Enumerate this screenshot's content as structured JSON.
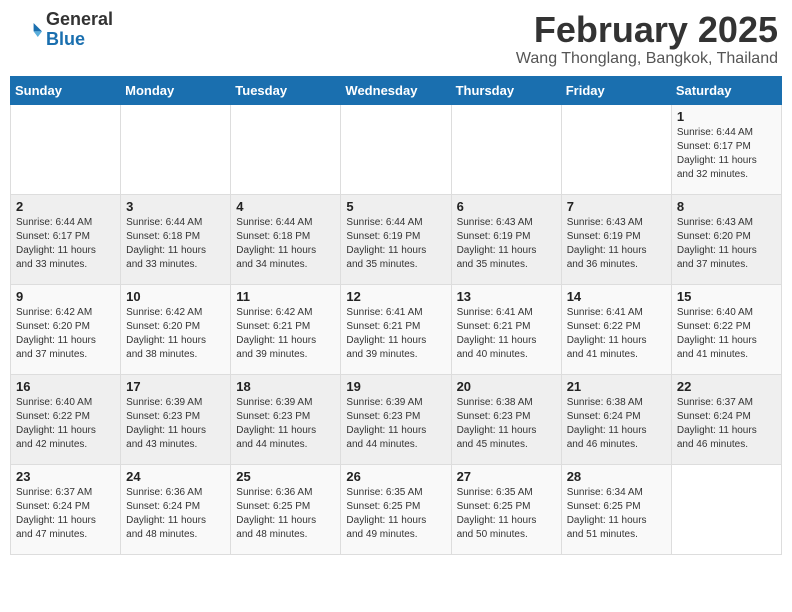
{
  "header": {
    "logo_general": "General",
    "logo_blue": "Blue",
    "month_year": "February 2025",
    "location": "Wang Thonglang, Bangkok, Thailand"
  },
  "weekdays": [
    "Sunday",
    "Monday",
    "Tuesday",
    "Wednesday",
    "Thursday",
    "Friday",
    "Saturday"
  ],
  "weeks": [
    {
      "days": [
        {
          "num": "",
          "info": ""
        },
        {
          "num": "",
          "info": ""
        },
        {
          "num": "",
          "info": ""
        },
        {
          "num": "",
          "info": ""
        },
        {
          "num": "",
          "info": ""
        },
        {
          "num": "",
          "info": ""
        },
        {
          "num": "1",
          "info": "Sunrise: 6:44 AM\nSunset: 6:17 PM\nDaylight: 11 hours\nand 32 minutes."
        }
      ]
    },
    {
      "days": [
        {
          "num": "2",
          "info": "Sunrise: 6:44 AM\nSunset: 6:17 PM\nDaylight: 11 hours\nand 33 minutes."
        },
        {
          "num": "3",
          "info": "Sunrise: 6:44 AM\nSunset: 6:18 PM\nDaylight: 11 hours\nand 33 minutes."
        },
        {
          "num": "4",
          "info": "Sunrise: 6:44 AM\nSunset: 6:18 PM\nDaylight: 11 hours\nand 34 minutes."
        },
        {
          "num": "5",
          "info": "Sunrise: 6:44 AM\nSunset: 6:19 PM\nDaylight: 11 hours\nand 35 minutes."
        },
        {
          "num": "6",
          "info": "Sunrise: 6:43 AM\nSunset: 6:19 PM\nDaylight: 11 hours\nand 35 minutes."
        },
        {
          "num": "7",
          "info": "Sunrise: 6:43 AM\nSunset: 6:19 PM\nDaylight: 11 hours\nand 36 minutes."
        },
        {
          "num": "8",
          "info": "Sunrise: 6:43 AM\nSunset: 6:20 PM\nDaylight: 11 hours\nand 37 minutes."
        }
      ]
    },
    {
      "days": [
        {
          "num": "9",
          "info": "Sunrise: 6:42 AM\nSunset: 6:20 PM\nDaylight: 11 hours\nand 37 minutes."
        },
        {
          "num": "10",
          "info": "Sunrise: 6:42 AM\nSunset: 6:20 PM\nDaylight: 11 hours\nand 38 minutes."
        },
        {
          "num": "11",
          "info": "Sunrise: 6:42 AM\nSunset: 6:21 PM\nDaylight: 11 hours\nand 39 minutes."
        },
        {
          "num": "12",
          "info": "Sunrise: 6:41 AM\nSunset: 6:21 PM\nDaylight: 11 hours\nand 39 minutes."
        },
        {
          "num": "13",
          "info": "Sunrise: 6:41 AM\nSunset: 6:21 PM\nDaylight: 11 hours\nand 40 minutes."
        },
        {
          "num": "14",
          "info": "Sunrise: 6:41 AM\nSunset: 6:22 PM\nDaylight: 11 hours\nand 41 minutes."
        },
        {
          "num": "15",
          "info": "Sunrise: 6:40 AM\nSunset: 6:22 PM\nDaylight: 11 hours\nand 41 minutes."
        }
      ]
    },
    {
      "days": [
        {
          "num": "16",
          "info": "Sunrise: 6:40 AM\nSunset: 6:22 PM\nDaylight: 11 hours\nand 42 minutes."
        },
        {
          "num": "17",
          "info": "Sunrise: 6:39 AM\nSunset: 6:23 PM\nDaylight: 11 hours\nand 43 minutes."
        },
        {
          "num": "18",
          "info": "Sunrise: 6:39 AM\nSunset: 6:23 PM\nDaylight: 11 hours\nand 44 minutes."
        },
        {
          "num": "19",
          "info": "Sunrise: 6:39 AM\nSunset: 6:23 PM\nDaylight: 11 hours\nand 44 minutes."
        },
        {
          "num": "20",
          "info": "Sunrise: 6:38 AM\nSunset: 6:23 PM\nDaylight: 11 hours\nand 45 minutes."
        },
        {
          "num": "21",
          "info": "Sunrise: 6:38 AM\nSunset: 6:24 PM\nDaylight: 11 hours\nand 46 minutes."
        },
        {
          "num": "22",
          "info": "Sunrise: 6:37 AM\nSunset: 6:24 PM\nDaylight: 11 hours\nand 46 minutes."
        }
      ]
    },
    {
      "days": [
        {
          "num": "23",
          "info": "Sunrise: 6:37 AM\nSunset: 6:24 PM\nDaylight: 11 hours\nand 47 minutes."
        },
        {
          "num": "24",
          "info": "Sunrise: 6:36 AM\nSunset: 6:24 PM\nDaylight: 11 hours\nand 48 minutes."
        },
        {
          "num": "25",
          "info": "Sunrise: 6:36 AM\nSunset: 6:25 PM\nDaylight: 11 hours\nand 48 minutes."
        },
        {
          "num": "26",
          "info": "Sunrise: 6:35 AM\nSunset: 6:25 PM\nDaylight: 11 hours\nand 49 minutes."
        },
        {
          "num": "27",
          "info": "Sunrise: 6:35 AM\nSunset: 6:25 PM\nDaylight: 11 hours\nand 50 minutes."
        },
        {
          "num": "28",
          "info": "Sunrise: 6:34 AM\nSunset: 6:25 PM\nDaylight: 11 hours\nand 51 minutes."
        },
        {
          "num": "",
          "info": ""
        }
      ]
    }
  ]
}
